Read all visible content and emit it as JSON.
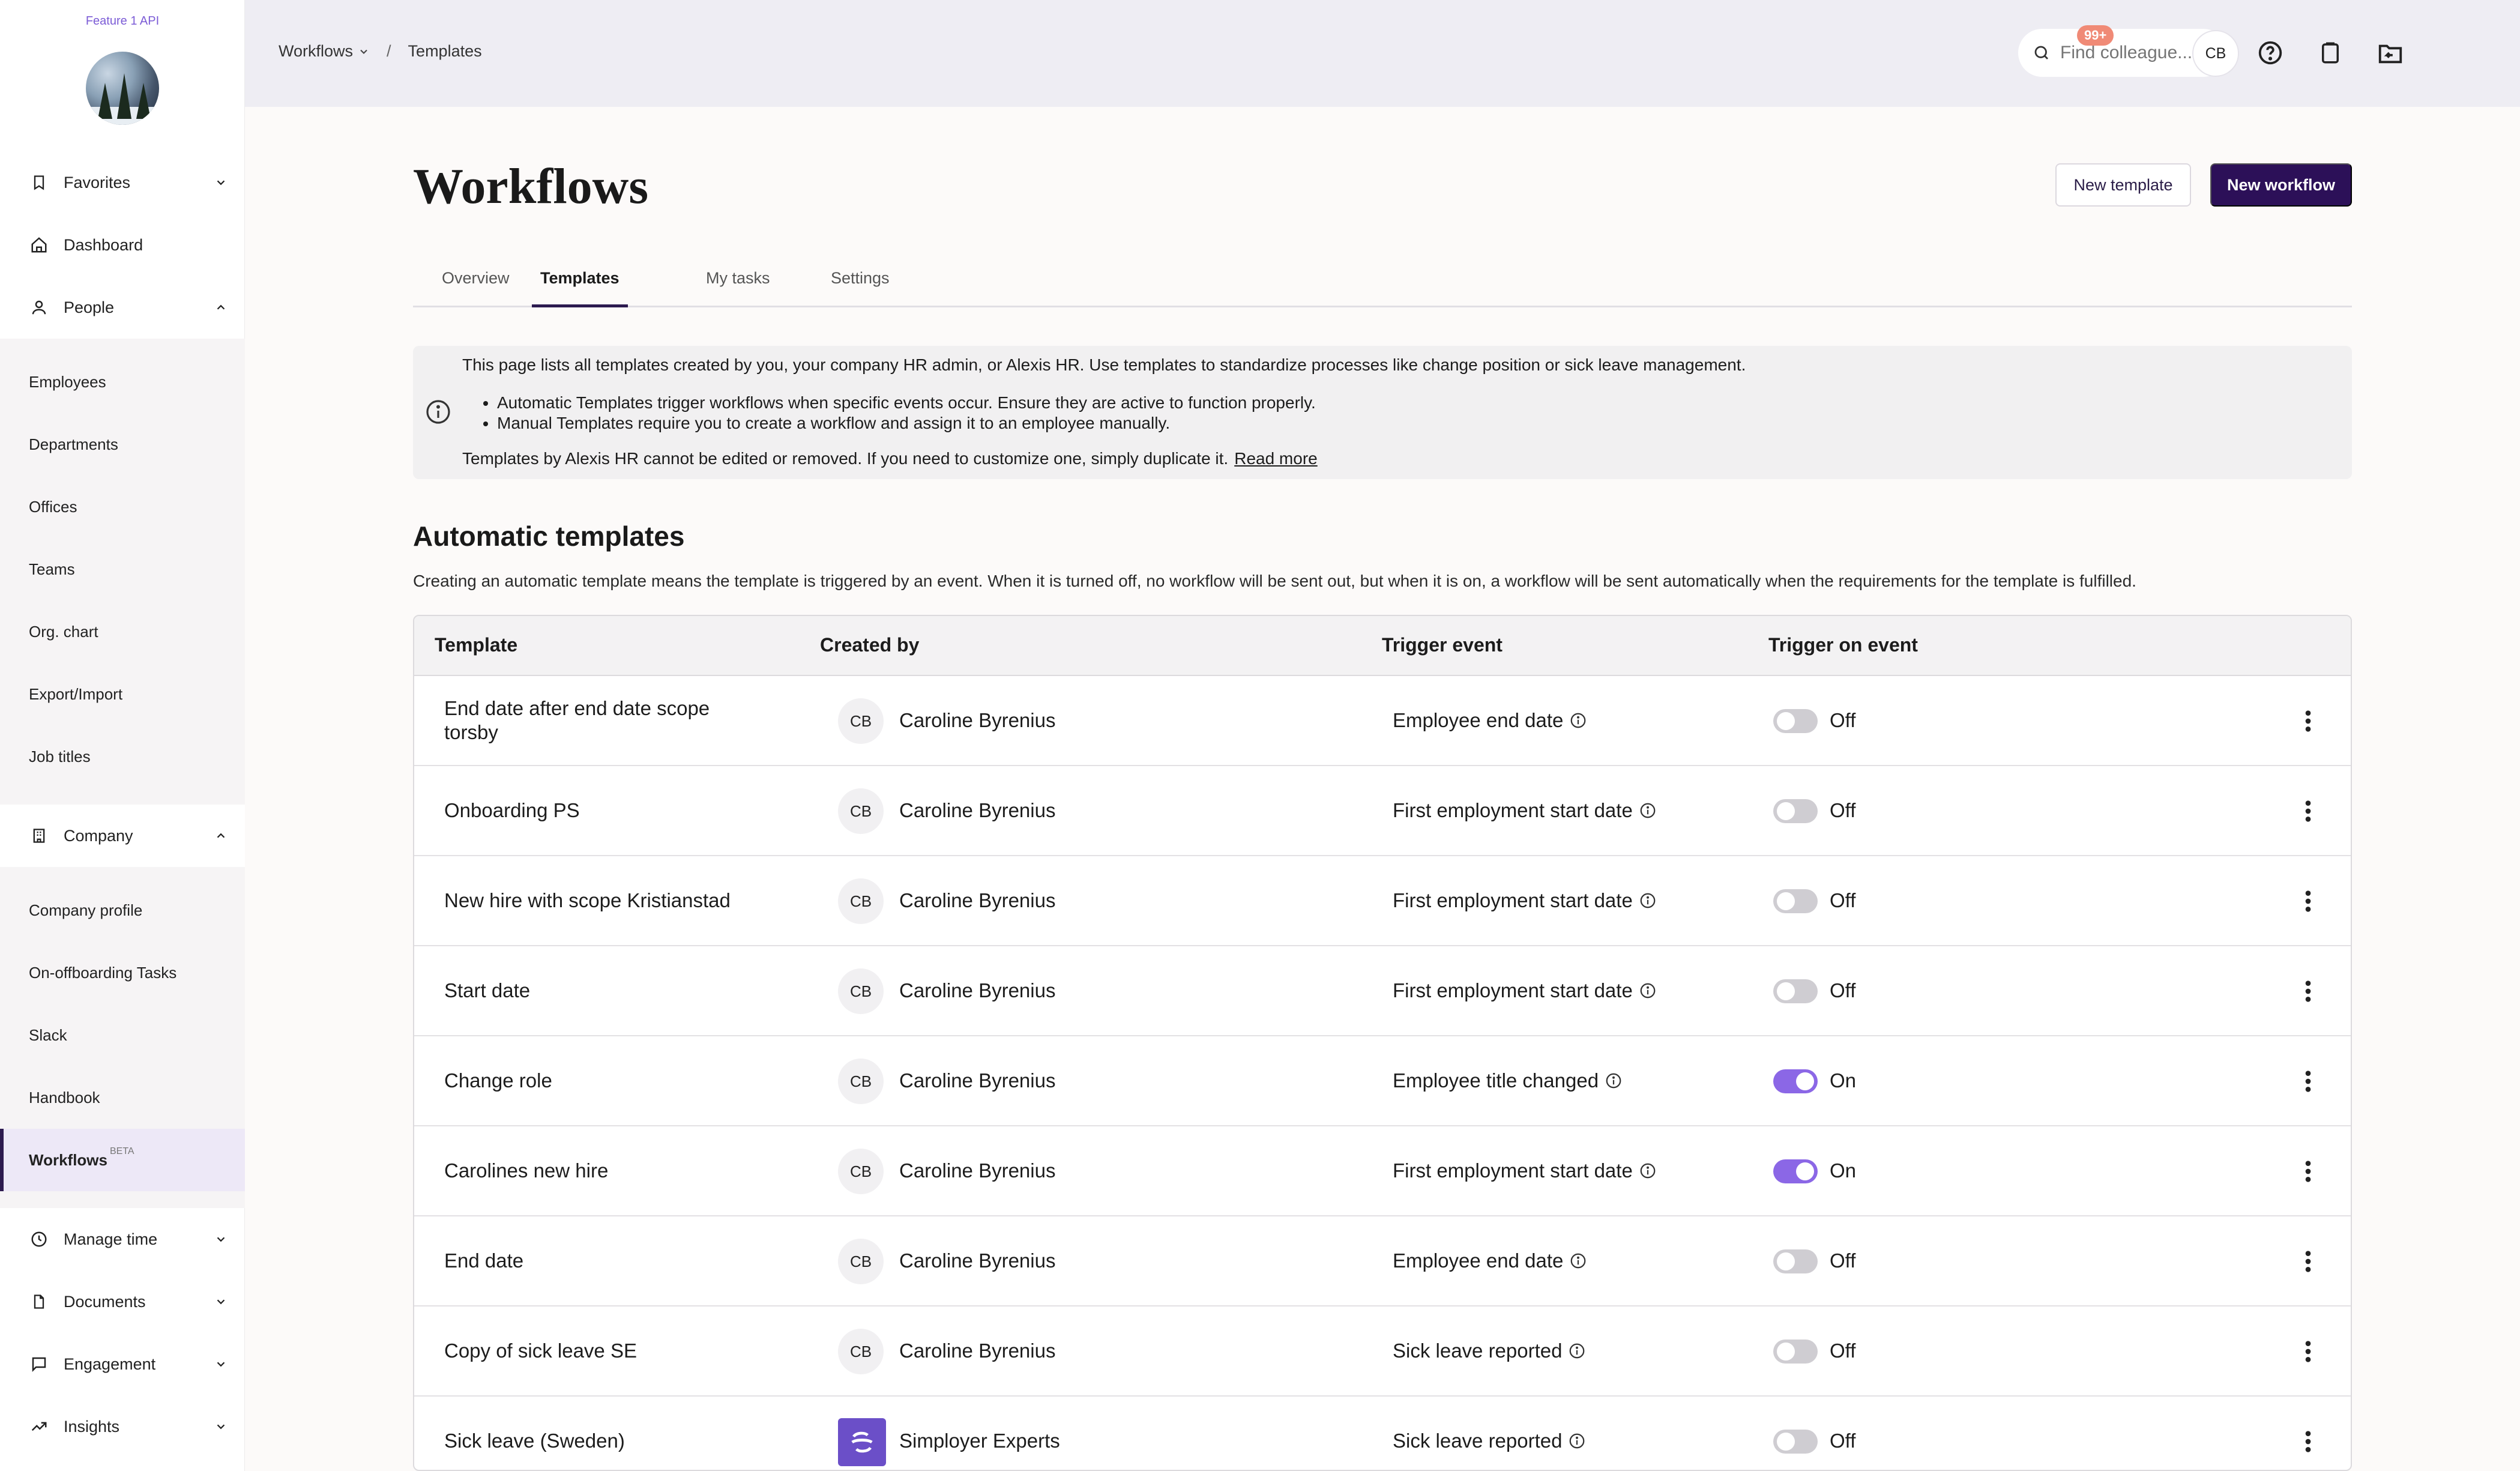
{
  "sidebar": {
    "feature_label": "Feature 1 API",
    "items": {
      "favorites": "Favorites",
      "dashboard": "Dashboard",
      "people": "People",
      "company": "Company",
      "manage_time": "Manage time",
      "documents": "Documents",
      "engagement": "Engagement",
      "insights": "Insights"
    },
    "people_sub": [
      "Employees",
      "Departments",
      "Offices",
      "Teams",
      "Org. chart",
      "Export/Import",
      "Job titles"
    ],
    "company_sub": [
      "Company profile",
      "On-offboarding Tasks",
      "Slack",
      "Handbook",
      "Workflows"
    ],
    "beta_label": "BETA"
  },
  "topbar": {
    "breadcrumb_root": "Workflows",
    "breadcrumb_sep": "/",
    "breadcrumb_current": "Templates",
    "search_placeholder": "Find colleague...",
    "notif_badge": "99+",
    "avatar_initials": "CB"
  },
  "page": {
    "title": "Workflows",
    "new_template_label": "New template",
    "new_workflow_label": "New workflow",
    "tabs": [
      "Overview",
      "Templates",
      "My tasks",
      "Settings"
    ],
    "active_tab": "Templates"
  },
  "info": {
    "line1": "This page lists all templates created by you, your company HR admin, or Alexis HR. Use templates to standardize processes like change position or sick leave management.",
    "bullet1": "Automatic Templates trigger workflows when specific events occur. Ensure they are active to function properly.",
    "bullet2": "Manual Templates require you to create a workflow and assign it to an employee manually.",
    "line2": "Templates by Alexis HR cannot be edited or removed. If you need to customize one, simply duplicate it.",
    "read_more": "Read more"
  },
  "automatic": {
    "title": "Automatic templates",
    "description": "Creating an automatic template means the template is triggered by an event. When it is turned off, no workflow will be sent out, but when it is on, a workflow will be sent automatically when the requirements for the template is fulfilled.",
    "columns": [
      "Template",
      "Created by",
      "Trigger event",
      "Trigger on event"
    ],
    "rows": [
      {
        "name": "End date after end date scope torsby",
        "creator_initials": "CB",
        "creator": "Caroline Byrenius",
        "trigger": "Employee end date",
        "state": "Off"
      },
      {
        "name": "Onboarding PS",
        "creator_initials": "CB",
        "creator": "Caroline Byrenius",
        "trigger": "First employment start date",
        "state": "Off"
      },
      {
        "name": "New hire with scope Kristianstad",
        "creator_initials": "CB",
        "creator": "Caroline Byrenius",
        "trigger": "First employment start date",
        "state": "Off"
      },
      {
        "name": "Start date",
        "creator_initials": "CB",
        "creator": "Caroline Byrenius",
        "trigger": "First employment start date",
        "state": "Off"
      },
      {
        "name": "Change role",
        "creator_initials": "CB",
        "creator": "Caroline Byrenius",
        "trigger": "Employee title changed",
        "state": "On"
      },
      {
        "name": "Carolines new hire",
        "creator_initials": "CB",
        "creator": "Caroline Byrenius",
        "trigger": "First employment start date",
        "state": "On"
      },
      {
        "name": "End date",
        "creator_initials": "CB",
        "creator": "Caroline Byrenius",
        "trigger": "Employee end date",
        "state": "Off"
      },
      {
        "name": "Copy of sick leave SE",
        "creator_initials": "CB",
        "creator": "Caroline Byrenius",
        "trigger": "Sick leave reported",
        "state": "Off"
      },
      {
        "name": "Sick leave (Sweden)",
        "creator_initials": "",
        "creator": "Simployer Experts",
        "trigger": "Sick leave reported",
        "state": "Off"
      }
    ]
  },
  "colors": {
    "primary": "#2c1058",
    "accent": "#8b67e6",
    "badge": "#f08a76"
  }
}
